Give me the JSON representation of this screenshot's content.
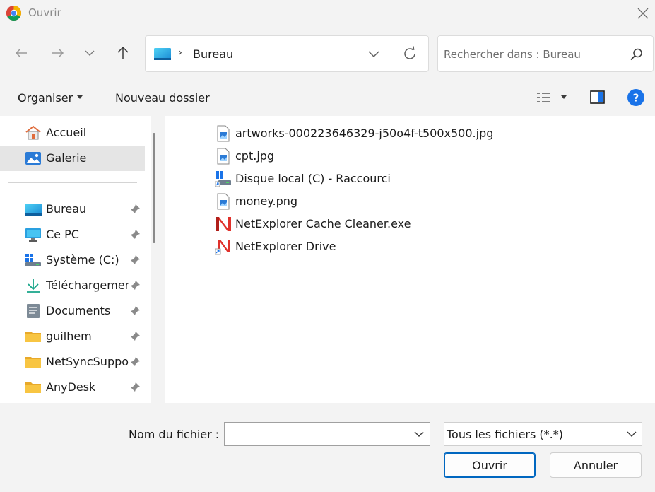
{
  "window": {
    "title": "Ouvrir"
  },
  "address": {
    "crumb": "Bureau",
    "separator": "›"
  },
  "search": {
    "placeholder": "Rechercher dans : Bureau"
  },
  "toolbar": {
    "organise_label": "Organiser",
    "new_folder_label": "Nouveau dossier"
  },
  "sidebar": {
    "items": [
      {
        "label": "Accueil",
        "icon": "home-icon",
        "selected": false
      },
      {
        "label": "Galerie",
        "icon": "gallery-icon",
        "selected": true
      },
      {
        "label": "Bureau",
        "icon": "desktop-icon",
        "pinned": true
      },
      {
        "label": "Ce PC",
        "icon": "computer-icon",
        "pinned": true
      },
      {
        "label": "Système (C:)",
        "icon": "drive-icon",
        "pinned": true
      },
      {
        "label": "Téléchargements",
        "icon": "download-icon",
        "pinned": true
      },
      {
        "label": "Documents",
        "icon": "documents-icon",
        "pinned": true
      },
      {
        "label": "guilhem",
        "icon": "folder-icon",
        "pinned": true
      },
      {
        "label": "NetSyncSupport",
        "icon": "folder-icon",
        "pinned": true
      },
      {
        "label": "AnyDesk",
        "icon": "folder-icon",
        "pinned": true
      }
    ]
  },
  "files": [
    {
      "name": "artworks-000223646329-j50o4f-t500x500.jpg",
      "icon": "image-file-icon"
    },
    {
      "name": "cpt.jpg",
      "icon": "image-file-icon"
    },
    {
      "name": "Disque local (C) - Raccourci",
      "icon": "drive-shortcut-icon"
    },
    {
      "name": "money.png",
      "icon": "image-file-icon"
    },
    {
      "name": "NetExplorer Cache Cleaner.exe",
      "icon": "netexplorer-icon"
    },
    {
      "name": "NetExplorer Drive",
      "icon": "netexplorer-shortcut-icon"
    }
  ],
  "footer": {
    "filename_label": "Nom du fichier :",
    "filename_value": "",
    "filter_value": "Tous les fichiers (*.*)",
    "open_label": "Ouvrir",
    "cancel_label": "Annuler"
  },
  "colors": {
    "accent": "#0067c0",
    "help": "#1a73e8",
    "selected_bg": "#e5e5e5",
    "folder": "#f8c542"
  }
}
